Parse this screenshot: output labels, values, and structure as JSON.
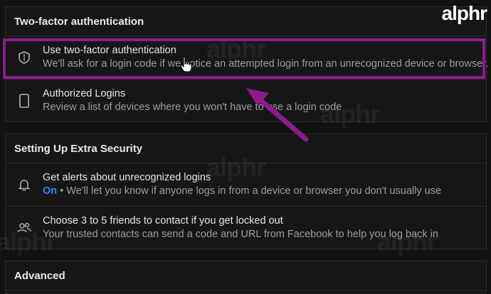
{
  "brand": {
    "logo_text": "alphr",
    "accent_color": "#8e1a8e",
    "link_color": "#2d88ff"
  },
  "two_factor": {
    "title": "Two-factor authentication",
    "items": [
      {
        "icon": "shield-icon",
        "title": "Use two-factor authentication",
        "desc": "We'll ask for a login code if we notice an attempted login from an unrecognized device or browser."
      },
      {
        "icon": "device-icon",
        "title": "Authorized Logins",
        "desc": "Review a list of devices where you won't have to use a login code"
      }
    ]
  },
  "extra_security": {
    "title": "Setting Up Extra Security",
    "items": [
      {
        "icon": "bell-icon",
        "title": "Get alerts about unrecognized logins",
        "status": "On",
        "desc": " • We'll let you know if anyone logs in from a device or browser you don't usually use"
      },
      {
        "icon": "friends-icon",
        "title": "Choose 3 to 5 friends to contact if you get locked out",
        "desc": "Your trusted contacts can send a code and URL from Facebook to help you log back in"
      }
    ]
  },
  "advanced": {
    "title": "Advanced"
  }
}
